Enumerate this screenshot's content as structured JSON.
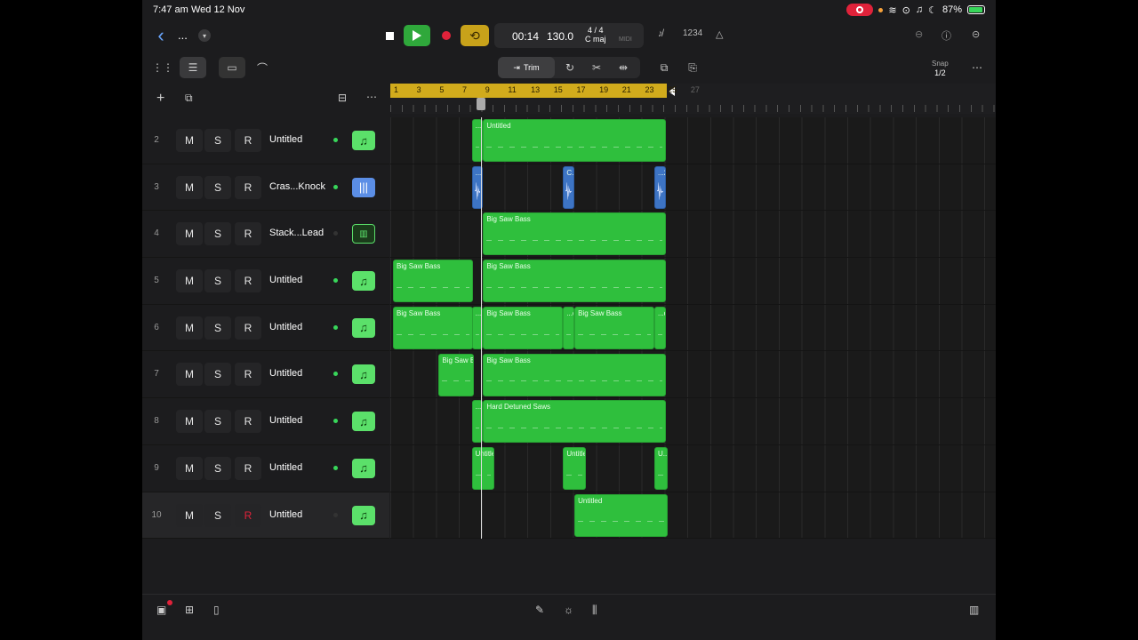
{
  "status_bar": {
    "time": "7:47 am",
    "date": "Wed 12 Nov",
    "battery": "87%"
  },
  "toolbar": {
    "project_menu": "...",
    "position": "00:14",
    "tempo": "130.0",
    "time_signature": "4 / 4",
    "key": "C maj",
    "midi_label": "MIDI",
    "count_in": "1234"
  },
  "edit_toolbar": {
    "trim_label": "Trim",
    "snap_label": "Snap",
    "snap_value": "1/2"
  },
  "ruler": {
    "bars": [
      "1",
      "3",
      "5",
      "7",
      "9",
      "11",
      "13",
      "15",
      "17",
      "19",
      "21",
      "23",
      "25",
      "27"
    ]
  },
  "tracks": [
    {
      "num": "2",
      "m": "M",
      "s": "S",
      "r": "R",
      "name": "Untitled",
      "led": true,
      "icon": "music-note-icon",
      "selected": false,
      "armed": false
    },
    {
      "num": "3",
      "m": "M",
      "s": "S",
      "r": "R",
      "name": "Cras...Knock",
      "led": true,
      "icon": "waveform-icon",
      "selected": false,
      "armed": false
    },
    {
      "num": "4",
      "m": "M",
      "s": "S",
      "r": "R",
      "name": "Stack...Lead",
      "led": false,
      "icon": "keyboard-synth-icon",
      "selected": false,
      "armed": false
    },
    {
      "num": "5",
      "m": "M",
      "s": "S",
      "r": "R",
      "name": "Untitled",
      "led": true,
      "icon": "music-note-icon",
      "selected": false,
      "armed": false
    },
    {
      "num": "6",
      "m": "M",
      "s": "S",
      "r": "R",
      "name": "Untitled",
      "led": true,
      "icon": "music-note-icon",
      "selected": false,
      "armed": false
    },
    {
      "num": "7",
      "m": "M",
      "s": "S",
      "r": "R",
      "name": "Untitled",
      "led": true,
      "icon": "music-note-icon",
      "selected": false,
      "armed": false
    },
    {
      "num": "8",
      "m": "M",
      "s": "S",
      "r": "R",
      "name": "Untitled",
      "led": true,
      "icon": "music-note-icon",
      "selected": false,
      "armed": false
    },
    {
      "num": "9",
      "m": "M",
      "s": "S",
      "r": "R",
      "name": "Untitled",
      "led": true,
      "icon": "music-note-icon",
      "selected": false,
      "armed": false
    },
    {
      "num": "10",
      "m": "M",
      "s": "S",
      "r": "R",
      "name": "Untitled",
      "led": false,
      "icon": "music-note-icon",
      "selected": true,
      "armed": true
    }
  ],
  "regions": [
    [
      {
        "name": "...c",
        "start": 7.9,
        "len": 1.0,
        "kind": "midi"
      },
      {
        "name": "Untitled",
        "start": 8.9,
        "len": 16.0,
        "kind": "midi"
      }
    ],
    [
      {
        "name": "...k",
        "start": 7.9,
        "len": 1.0,
        "kind": "audio"
      },
      {
        "name": "C...1",
        "start": 15.9,
        "len": 1.0,
        "kind": "audio"
      },
      {
        "name": "...2",
        "start": 23.9,
        "len": 1.0,
        "kind": "audio"
      }
    ],
    [
      {
        "name": "Big Saw Bass",
        "start": 8.9,
        "len": 16.0,
        "kind": "midi"
      }
    ],
    [
      {
        "name": "Big Saw Bass",
        "start": 1.0,
        "len": 7.0,
        "kind": "midi"
      },
      {
        "name": "Big Saw Bass",
        "start": 8.9,
        "len": 16.0,
        "kind": "midi"
      }
    ],
    [
      {
        "name": "Big Saw Bass",
        "start": 1.0,
        "len": 7.0,
        "kind": "midi"
      },
      {
        "name": "...c",
        "start": 7.9,
        "len": 1.0,
        "kind": "midi"
      },
      {
        "name": "Big Saw Bass",
        "start": 8.9,
        "len": 7.0,
        "kind": "midi"
      },
      {
        "name": "...d",
        "start": 15.9,
        "len": 1.0,
        "kind": "midi"
      },
      {
        "name": "Big Saw Bass",
        "start": 16.9,
        "len": 7.0,
        "kind": "midi"
      },
      {
        "name": "...d",
        "start": 23.9,
        "len": 1.0,
        "kind": "midi"
      }
    ],
    [
      {
        "name": "Big Saw Bass",
        "start": 5.0,
        "len": 3.1,
        "kind": "midi"
      },
      {
        "name": "Big Saw Bass",
        "start": 8.9,
        "len": 16.0,
        "kind": "midi"
      }
    ],
    [
      {
        "name": "...k",
        "start": 7.9,
        "len": 1.0,
        "kind": "midi"
      },
      {
        "name": "Hard Detuned Saws",
        "start": 8.9,
        "len": 16.0,
        "kind": "midi"
      }
    ],
    [
      {
        "name": "Untitled",
        "start": 7.9,
        "len": 2.0,
        "kind": "midi"
      },
      {
        "name": "Untitled",
        "start": 15.9,
        "len": 2.0,
        "kind": "midi"
      },
      {
        "name": "U...d",
        "start": 23.9,
        "len": 1.2,
        "kind": "midi"
      }
    ],
    [
      {
        "name": "Untitled",
        "start": 16.9,
        "len": 8.2,
        "kind": "midi"
      }
    ]
  ],
  "playhead_bar": 8.7,
  "cycle": {
    "start": 1,
    "end": 25
  }
}
